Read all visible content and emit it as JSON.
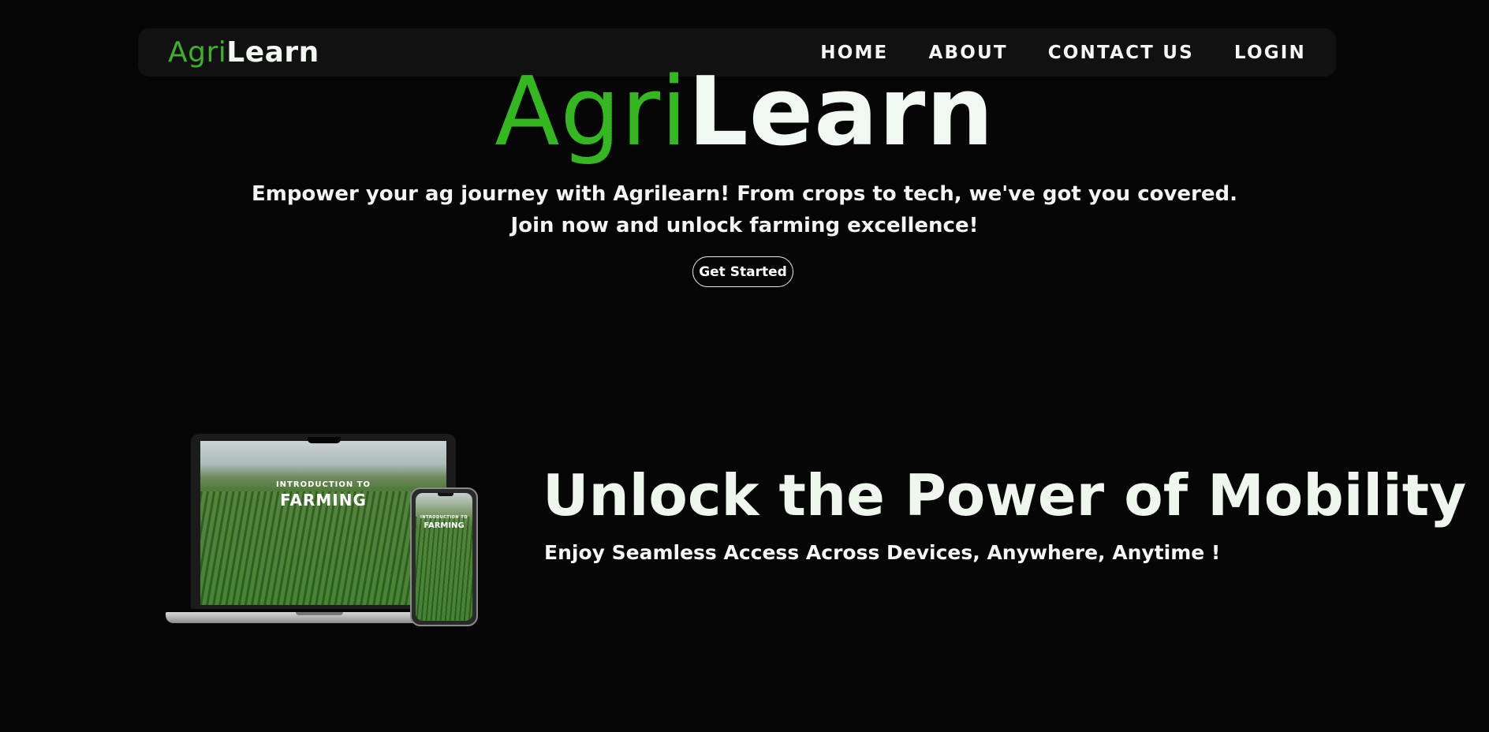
{
  "navbar": {
    "logo_part1": "Agri",
    "logo_part2": "Learn",
    "links": [
      "HOME",
      "ABOUT",
      "CONTACT US",
      "LOGIN"
    ]
  },
  "hero": {
    "title_part1": "Agri",
    "title_part2": "Learn",
    "subtitle_line1": "Empower your ag journey with Agrilearn! From crops to tech, we've got you covered.",
    "subtitle_line2": "Join now and unlock farming excellence!",
    "cta_label": "Get Started"
  },
  "feature": {
    "image_text_small": "INTRODUCTION TO",
    "image_text_large": "FARMING",
    "title": "Unlock the Power of Mobility",
    "subtitle": "Enjoy Seamless Access Across Devices, Anywhere, Anytime !"
  },
  "colors": {
    "background": "#060606",
    "navbar": "#111111",
    "accent_green": "#33b820",
    "text": "#f2f7f2"
  }
}
